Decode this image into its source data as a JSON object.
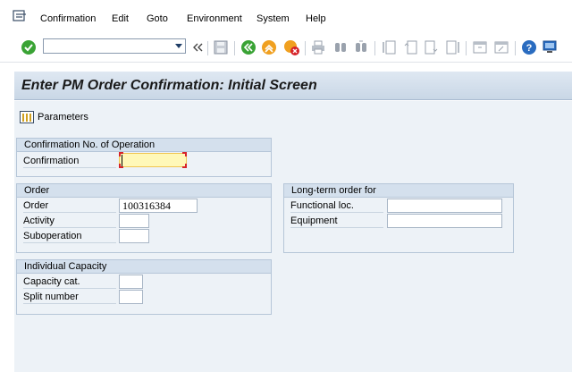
{
  "menubar": {
    "items": [
      "Confirmation",
      "Edit",
      "Goto",
      "Environment",
      "System",
      "Help"
    ]
  },
  "toolbar": {
    "command_field_value": "",
    "icons": [
      "enter-icon",
      "back-icon",
      "save-icon",
      "green-back-icon",
      "exit-icon",
      "cancel-icon",
      "print-icon",
      "find-icon",
      "find-next-icon",
      "first-page-icon",
      "previous-page-icon",
      "next-page-icon",
      "last-page-icon",
      "create-session-icon",
      "shortcut-icon",
      "help-icon",
      "customize-layout-icon"
    ]
  },
  "title": "Enter PM Order Confirmation: Initial Screen",
  "app_toolbar": {
    "parameters_label": "Parameters"
  },
  "confirmation_group": {
    "header": "Confirmation No. of Operation",
    "confirmation_label": "Confirmation",
    "confirmation_value": ""
  },
  "order_group": {
    "header": "Order",
    "order_label": "Order",
    "order_value": "100316384",
    "activity_label": "Activity",
    "activity_value": "",
    "suboperation_label": "Suboperation",
    "suboperation_value": ""
  },
  "longterm_group": {
    "header": "Long-term order for",
    "functional_loc_label": "Functional loc.",
    "functional_loc_value": "",
    "equipment_label": "Equipment",
    "equipment_value": ""
  },
  "capacity_group": {
    "header": "Individual Capacity",
    "capacity_cat_label": "Capacity cat.",
    "capacity_cat_value": "",
    "split_number_label": "Split number",
    "split_number_value": ""
  },
  "colors": {
    "title_bar": "#c9d7e6",
    "group_header": "#d4e0ed",
    "app_background": "#edf2f7",
    "focus_field": "#fff8b8",
    "focus_marker": "#d6232a"
  }
}
